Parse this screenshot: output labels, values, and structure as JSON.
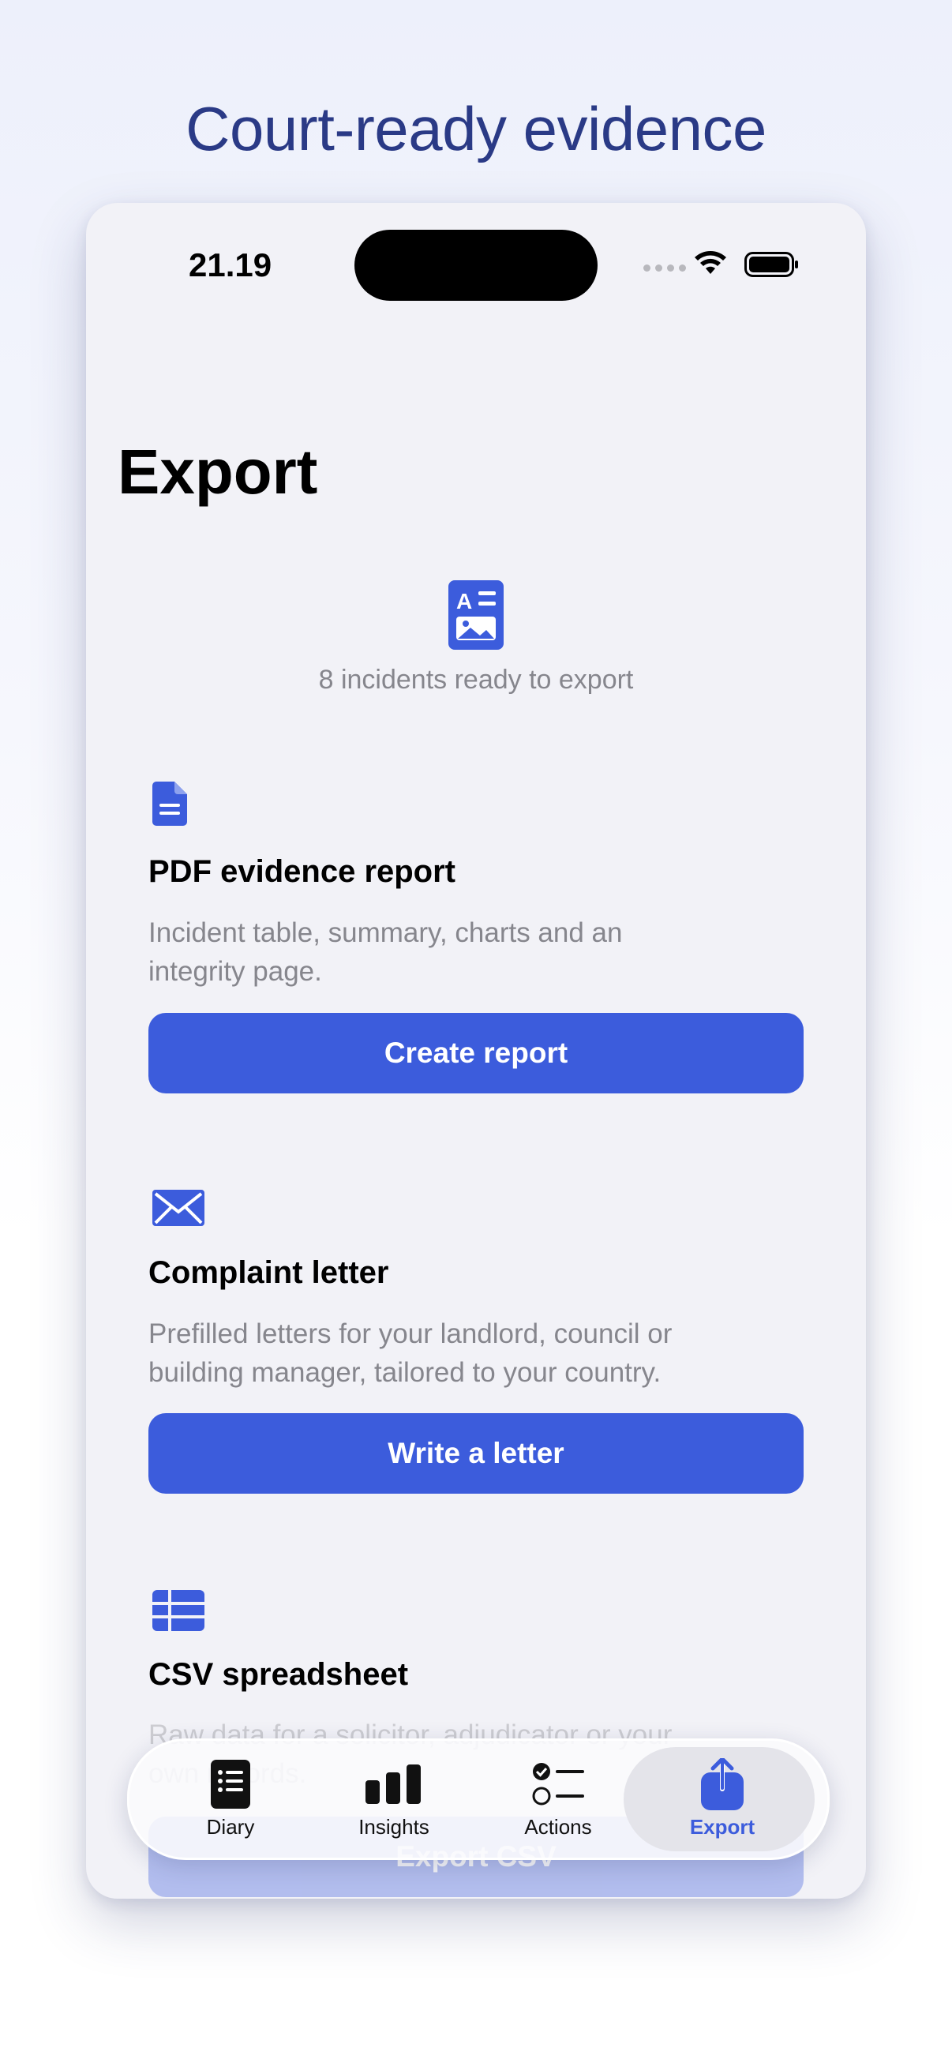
{
  "headline": "Court-ready evidence",
  "status": {
    "time": "21.19"
  },
  "page": {
    "title": "Export"
  },
  "summary": {
    "text": "8 incidents ready to export"
  },
  "sections": [
    {
      "icon": "document-icon",
      "title": "PDF evidence report",
      "description": "Incident table, summary, charts and an integrity page.",
      "button": "Create report"
    },
    {
      "icon": "envelope-icon",
      "title": "Complaint letter",
      "description": "Prefilled letters for your landlord, council or building manager, tailored to your country.",
      "button": "Write a letter"
    },
    {
      "icon": "table-icon",
      "title": "CSV spreadsheet",
      "description": "Raw data for a solicitor, adjudicator or your own records.",
      "button": "Export CSV"
    }
  ],
  "tabs": [
    {
      "label": "Diary",
      "icon": "diary-icon",
      "active": false
    },
    {
      "label": "Insights",
      "icon": "bar-chart-icon",
      "active": false
    },
    {
      "label": "Actions",
      "icon": "checklist-icon",
      "active": false
    },
    {
      "label": "Export",
      "icon": "share-icon",
      "active": true
    }
  ],
  "colors": {
    "accent": "#3c5cdc",
    "headline": "#2a3a86",
    "background": "#f2f2f7"
  }
}
